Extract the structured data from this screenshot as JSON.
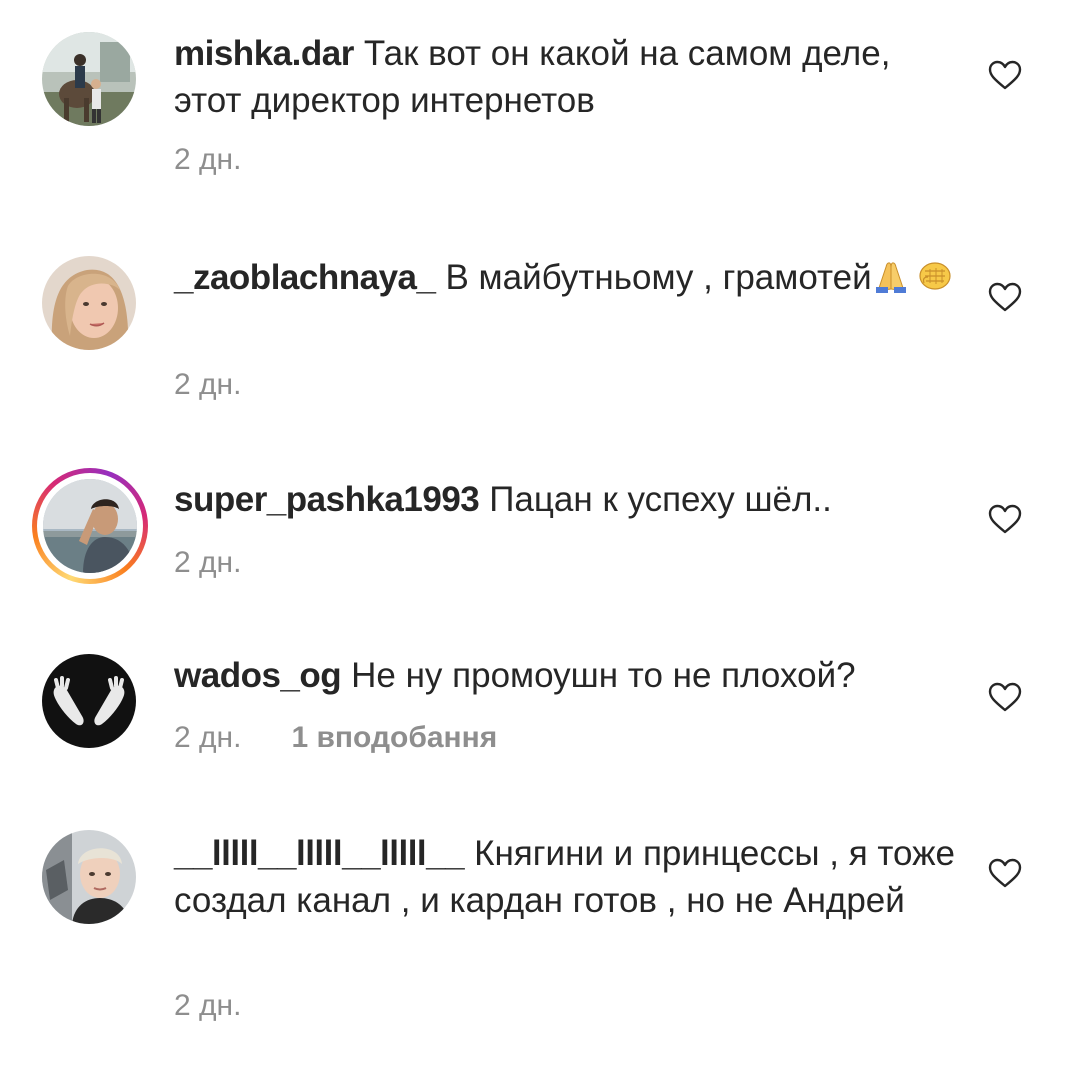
{
  "comments": [
    {
      "username": "mishka.dar",
      "text": "Так вот он какой на самом деле, этот директор интернетов",
      "time": "2 дн.",
      "likes": ""
    },
    {
      "username": "_zaoblachnaya_",
      "text": "В майбутньому , грамотей",
      "emoji": [
        "folded-hands-icon",
        "fist-icon"
      ],
      "time": "2 дн.",
      "likes": ""
    },
    {
      "username": "super_pashka1993",
      "text": "Пацан к успеху шёл..",
      "time": "2 дн.",
      "likes": "",
      "has_story": true
    },
    {
      "username": "wados_og",
      "text": "Не ну промоушн то не плохой?",
      "time": "2 дн.",
      "likes": "1 вподобання"
    },
    {
      "username": "__lllll__lllll__lllll__",
      "text": "Княгини и принцессы , я тоже создал канал , и кардан готов , но не Андрей",
      "time": "2 дн.",
      "likes": ""
    }
  ],
  "colors": {
    "text": "#262626",
    "secondary": "#8e8e8e",
    "story_ring": [
      "#feda75",
      "#fa7e1e",
      "#d62976",
      "#962fbf"
    ]
  }
}
